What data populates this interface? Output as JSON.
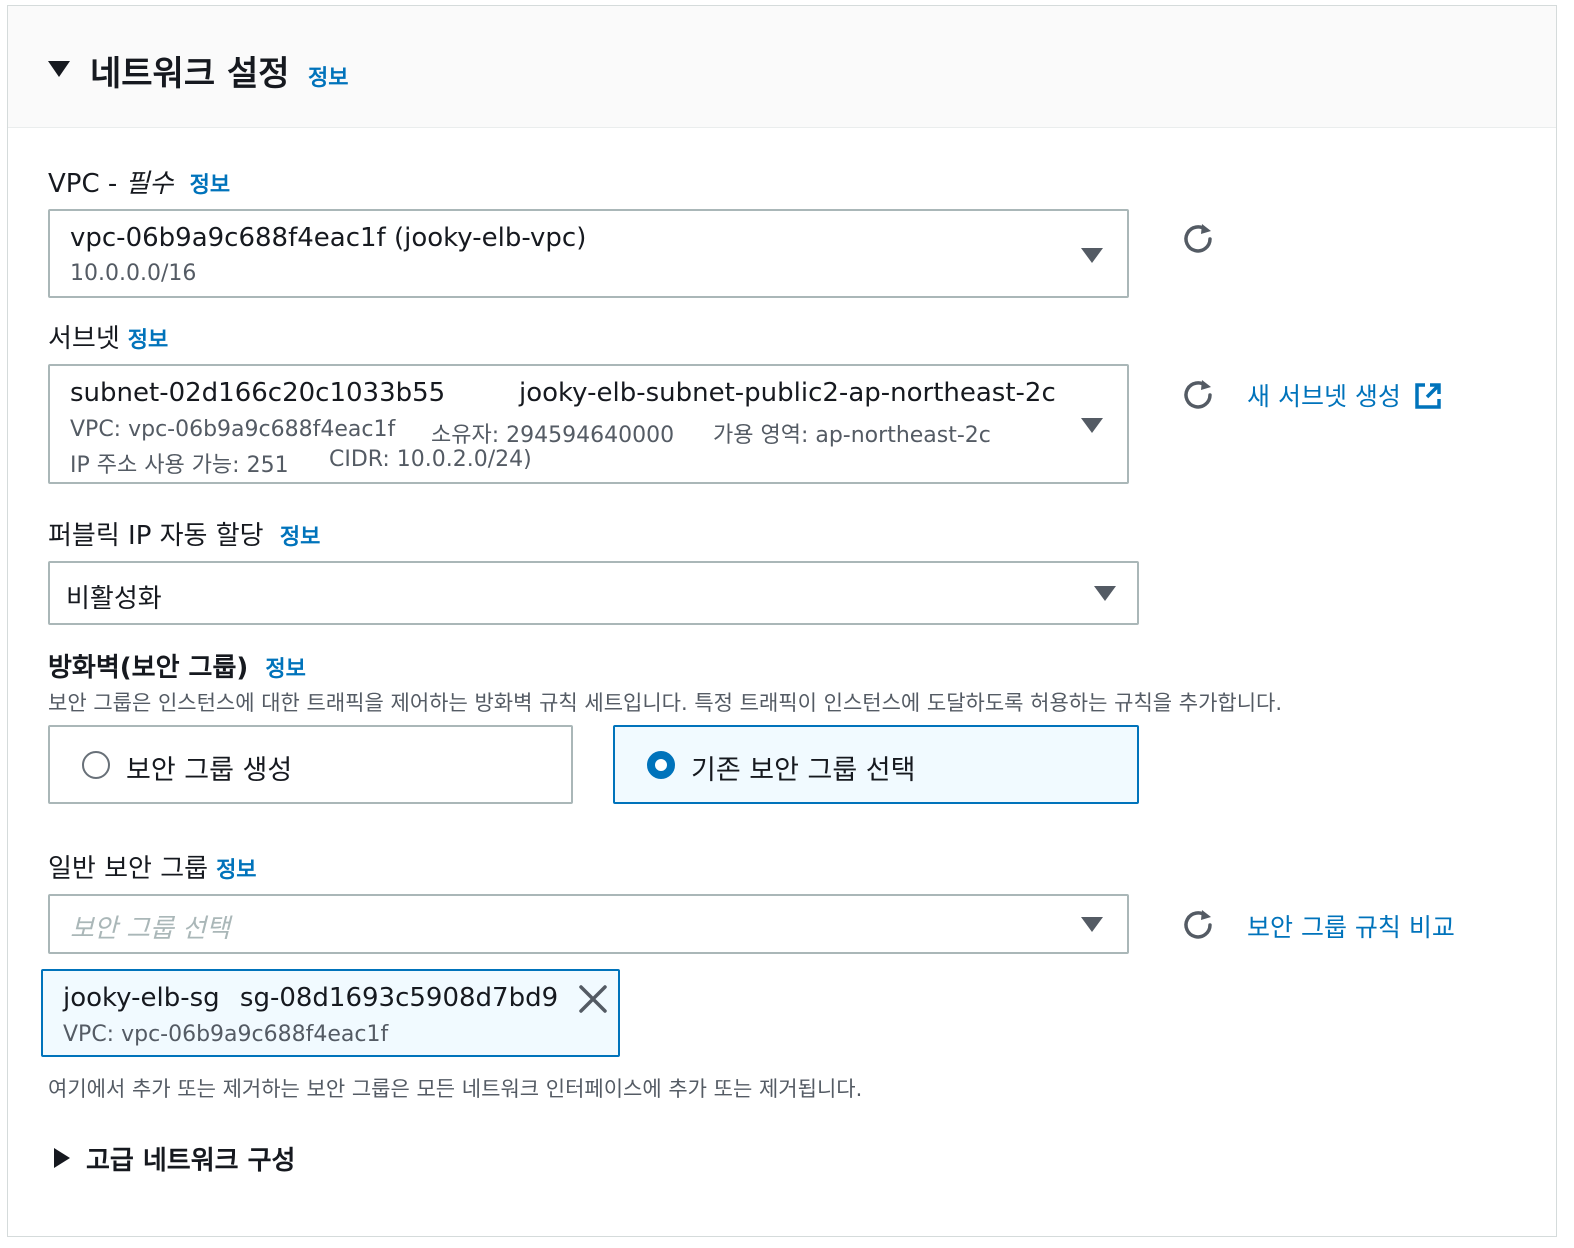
{
  "header": {
    "title": "네트워크 설정",
    "info": "정보"
  },
  "vpc": {
    "label": "VPC -",
    "required": "필수",
    "info": "정보",
    "value": "vpc-06b9a9c688f4eac1f (jooky-elb-vpc)",
    "cidr": "10.0.0.0/16"
  },
  "subnet": {
    "label": "서브넷",
    "info": "정보",
    "id": "subnet-02d166c20c1033b55",
    "name": "jooky-elb-subnet-public2-ap-northeast-2c",
    "vpc": "VPC: vpc-06b9a9c688f4eac1f",
    "owner": "소유자: 294594640000",
    "az": "가용 영역: ap-northeast-2c",
    "ips": "IP 주소 사용 가능: 251",
    "cidr": "CIDR: 10.0.2.0/24)",
    "create_link": "새 서브넷 생성"
  },
  "public_ip": {
    "label": "퍼블릭 IP 자동 할당",
    "info": "정보",
    "value": "비활성화"
  },
  "firewall": {
    "title": "방화벽(보안 그룹)",
    "info": "정보",
    "description": "보안 그룹은 인스턴스에 대한 트래픽을 제어하는 방화벽 규칙 세트입니다. 특정 트래픽이 인스턴스에 도달하도록 허용하는 규칙을 추가합니다.",
    "options": [
      {
        "label": "보안 그룹 생성",
        "selected": false
      },
      {
        "label": "기존 보안 그룹 선택",
        "selected": true
      }
    ]
  },
  "common_sg": {
    "label": "일반 보안 그룹",
    "info": "정보",
    "placeholder": "보안 그룹 선택",
    "compare_link": "보안 그룹 규칙 비교",
    "selected_token": {
      "name": "jooky-elb-sg",
      "id": "sg-08d1693c5908d7bd9",
      "vpc": "VPC: vpc-06b9a9c688f4eac1f"
    },
    "note": "여기에서 추가 또는 제거하는 보안 그룹은 모든 네트워크 인터페이스에 추가 또는 제거됩니다."
  },
  "advanced": {
    "label": "고급 네트워크 구성"
  },
  "colors": {
    "link": "#0073bb",
    "border": "#aab7b8",
    "selected_bg": "#f1faff",
    "text": "#16191f",
    "muted": "#545b64"
  },
  "icons": {
    "refresh": "refresh-icon",
    "external": "external-link-icon",
    "close": "close-icon",
    "caret_down": "caret-down-icon",
    "caret_right": "caret-right-icon"
  }
}
